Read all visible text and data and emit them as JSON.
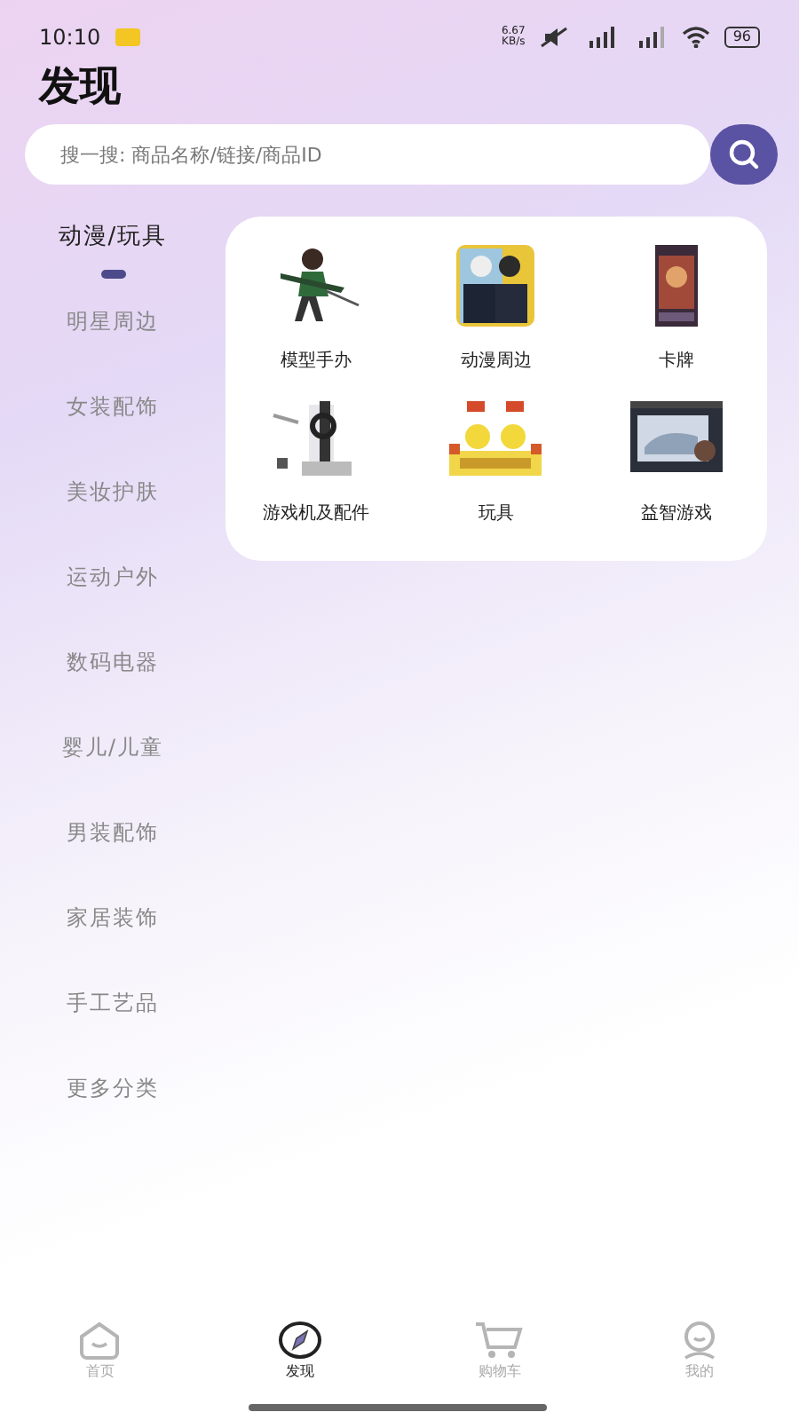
{
  "status_bar": {
    "time": "10:10",
    "speed": "6.67",
    "speed_unit": "KB/s",
    "battery": "96"
  },
  "title": "发现",
  "search": {
    "placeholder": "搜一搜: 商品名称/链接/商品ID"
  },
  "categories": [
    {
      "label": "动漫/玩具",
      "selected": true
    },
    {
      "label": "明星周边",
      "selected": false
    },
    {
      "label": "女装配饰",
      "selected": false
    },
    {
      "label": "美妆护肤",
      "selected": false
    },
    {
      "label": "运动户外",
      "selected": false
    },
    {
      "label": "数码电器",
      "selected": false
    },
    {
      "label": "婴儿/儿童",
      "selected": false
    },
    {
      "label": "男装配饰",
      "selected": false
    },
    {
      "label": "家居装饰",
      "selected": false
    },
    {
      "label": "手工艺品",
      "selected": false
    },
    {
      "label": "更多分类",
      "selected": false
    }
  ],
  "subcategories": [
    {
      "label": "模型手办",
      "kind": "picture"
    },
    {
      "label": "动漫周边",
      "kind": "picture"
    },
    {
      "label": "卡牌",
      "kind": "picture"
    },
    {
      "label": "游戏机及配件",
      "kind": "picture"
    },
    {
      "label": "玩具",
      "kind": "picture"
    },
    {
      "label": "益智游戏",
      "kind": "picture"
    }
  ],
  "tab_bar": [
    {
      "label": "首页",
      "kind": "home",
      "selected": false
    },
    {
      "label": "发现",
      "kind": "compass",
      "selected": true
    },
    {
      "label": "购物车",
      "kind": "cart",
      "selected": false
    },
    {
      "label": "我的",
      "kind": "person",
      "selected": false
    }
  ]
}
